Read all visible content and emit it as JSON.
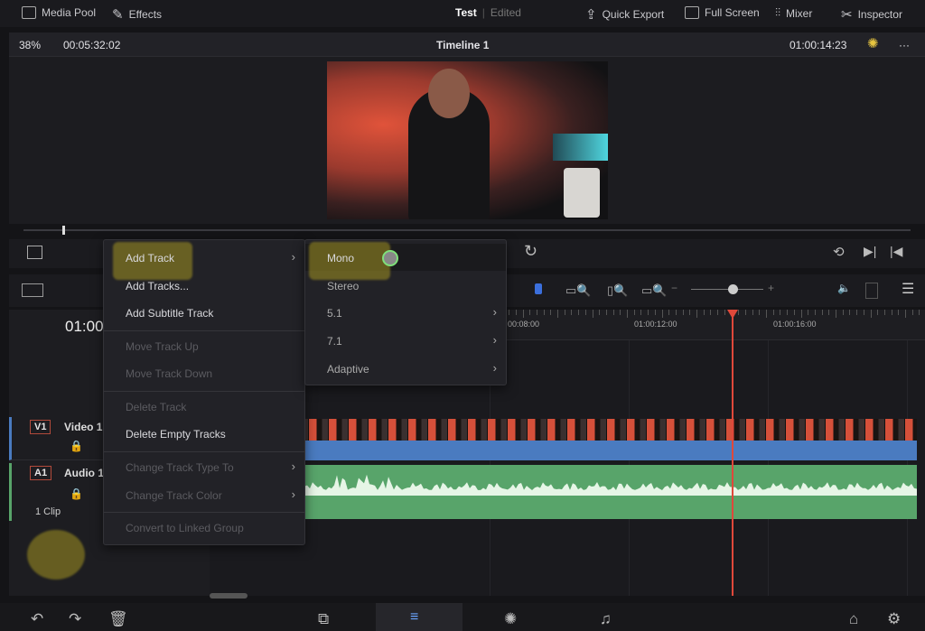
{
  "topbar": {
    "media_pool": "Media Pool",
    "effects": "Effects",
    "project": "Test",
    "status": "Edited",
    "quick_export": "Quick Export",
    "full_screen": "Full Screen",
    "mixer": "Mixer",
    "inspector": "Inspector"
  },
  "viewer_bar": {
    "zoom": "38%",
    "duration": "00:05:32:02",
    "timeline": "Timeline 1",
    "timecode": "01:00:14:23"
  },
  "timeline": {
    "timecode": "01:00",
    "ruler": [
      "00:08:00",
      "01:00:12:00",
      "01:00:16:00"
    ],
    "playhead_timecode": "01:00:14:23"
  },
  "tracks": [
    {
      "tag": "V1",
      "name": "Video 1",
      "color": "#4a7bc0"
    },
    {
      "tag": "A1",
      "name": "Audio 1",
      "clips": "1 Clip",
      "color": "#58a46a"
    }
  ],
  "menu": {
    "items": [
      {
        "label": "Add Track",
        "submenu": true,
        "disabled": false
      },
      {
        "label": "Add Tracks...",
        "disabled": false
      },
      {
        "label": "Add Subtitle Track",
        "disabled": false
      },
      {
        "label": "Move Track Up",
        "disabled": true
      },
      {
        "label": "Move Track Down",
        "disabled": true
      },
      {
        "label": "Delete Track",
        "disabled": true
      },
      {
        "label": "Delete Empty Tracks",
        "disabled": false
      },
      {
        "label": "Change Track Type To",
        "submenu": true,
        "disabled": true
      },
      {
        "label": "Change Track Color",
        "submenu": true,
        "disabled": true
      },
      {
        "label": "Convert to Linked Group",
        "disabled": true
      }
    ]
  },
  "submenu": {
    "items": [
      {
        "label": "Mono"
      },
      {
        "label": "Stereo"
      },
      {
        "label": "5.1",
        "submenu": true
      },
      {
        "label": "7.1",
        "submenu": true
      },
      {
        "label": "Adaptive",
        "submenu": true
      }
    ]
  },
  "colors": {
    "playhead": "#e0483a",
    "video_clip": "#4a7bc0",
    "audio_clip": "#58a46a",
    "highlight": "#a29321"
  }
}
